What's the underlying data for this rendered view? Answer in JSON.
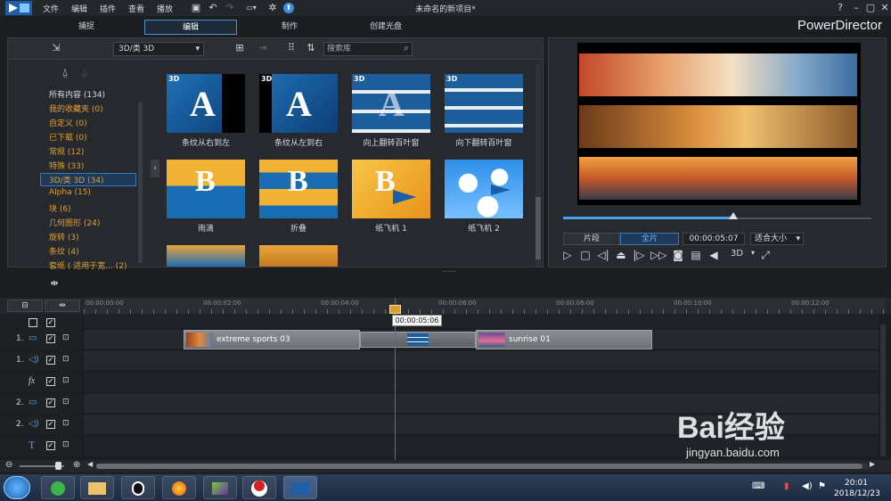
{
  "menu": [
    "文件",
    "编辑",
    "插件",
    "查看",
    "播放"
  ],
  "window_title": "未命名的新项目*",
  "mode_tabs": [
    "捕捉",
    "编辑",
    "制作",
    "创建光盘"
  ],
  "brand": "PowerDirector",
  "library": {
    "dropdown": "3D/类 3D",
    "search_placeholder": "搜索库",
    "categories": [
      "所有内容 (134)",
      "我的收藏夹 (0)",
      "自定义 (0)",
      "已下载 (0)",
      "常规 (12)",
      "特殊 (33)",
      "3D/类 3D (34)",
      "Alpha (15)",
      "块 (6)",
      "几何图形 (24)",
      "旋转 (3)",
      "条纹 (4)",
      "套纸 ( 适用于宽... (2)"
    ],
    "tiles": [
      {
        "label": "条纹从右到左",
        "badge": "3D"
      },
      {
        "label": "条纹从左到右",
        "badge": "3D"
      },
      {
        "label": "向上翻转百叶窗",
        "badge": "3D"
      },
      {
        "label": "向下翻转百叶窗",
        "badge": "3D"
      },
      {
        "label": "雨滴",
        "badge": ""
      },
      {
        "label": "折叠",
        "badge": ""
      },
      {
        "label": "纸飞机 1",
        "badge": ""
      },
      {
        "label": "纸飞机 2",
        "badge": ""
      }
    ]
  },
  "preview": {
    "btn_clip": "片段",
    "btn_movie": "全片",
    "timecode": "00:00:05:07",
    "fit": "适合大小",
    "mode3d": "3D",
    "progress": 0.55
  },
  "timeline": {
    "ticks": [
      "00:00:00:00",
      "00:00:02:00",
      "00:00:04:00",
      "00:00:06:00",
      "00:00:08:00",
      "00:00:10:00",
      "00:00:12:00"
    ],
    "tooltip": "00:00:05:06",
    "tracks": [
      {
        "num": "1.",
        "icon": "video"
      },
      {
        "num": "1.",
        "icon": "audio"
      },
      {
        "num": "",
        "icon": "fx"
      },
      {
        "num": "2.",
        "icon": "video"
      },
      {
        "num": "2.",
        "icon": "audio"
      },
      {
        "num": "",
        "icon": "text"
      }
    ],
    "clips": [
      {
        "name": "extreme sports 03"
      },
      {
        "name": "sunrise 01"
      }
    ]
  },
  "taskbar": {
    "time": "20:01",
    "date": "2018/12/23"
  },
  "watermark": {
    "brand": "Bai经验",
    "url": "jingyan.baidu.com"
  }
}
